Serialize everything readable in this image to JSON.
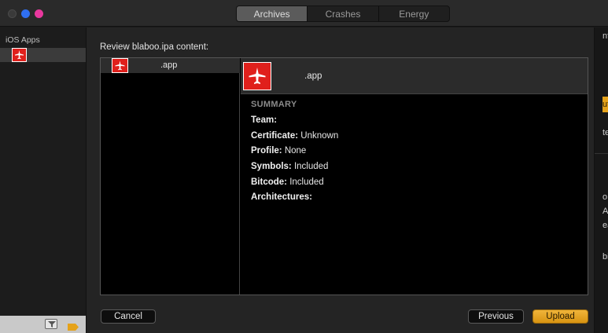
{
  "toolbar": {
    "tabs": [
      {
        "label": "Archives",
        "active": true
      },
      {
        "label": "Crashes",
        "active": false
      },
      {
        "label": "Energy",
        "active": false
      }
    ]
  },
  "sidebar": {
    "heading": "iOS Apps"
  },
  "sheet": {
    "title": "Review blaboo.ipa content:",
    "list": {
      "selected_label": ".app"
    },
    "detail": {
      "app_label": ".app",
      "summary_title": "SUMMARY",
      "rows": [
        {
          "key": "Team:",
          "value": ""
        },
        {
          "key": "Certificate:",
          "value": "Unknown"
        },
        {
          "key": "Profile:",
          "value": "None"
        },
        {
          "key": "Symbols:",
          "value": "Included"
        },
        {
          "key": "Bitcode:",
          "value": "Included"
        },
        {
          "key": "Architectures:",
          "value": ""
        }
      ]
    },
    "buttons": {
      "cancel": "Cancel",
      "previous": "Previous",
      "upload": "Upload"
    }
  },
  "right_edge": {
    "fragments": [
      "nfo",
      "ut",
      "te",
      "o.",
      "A",
      "ea",
      "bi"
    ]
  },
  "colors": {
    "accent_upload": "#e5a21a",
    "app_icon_red": "#e0201c",
    "traffic_min": "#2f6ff1",
    "traffic_max": "#e9389e"
  }
}
